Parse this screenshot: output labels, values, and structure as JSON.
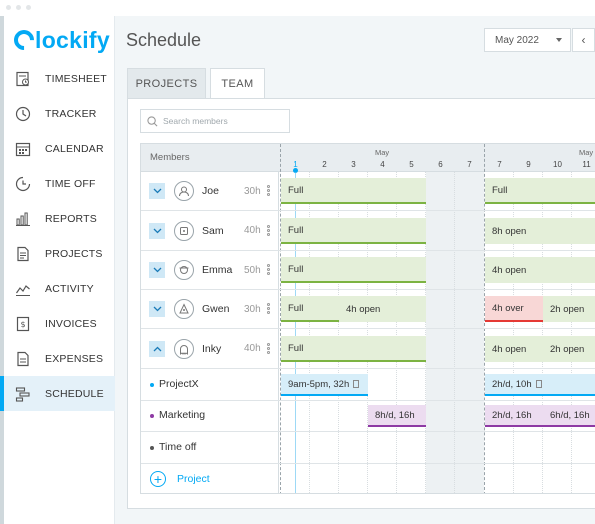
{
  "app": {
    "logo_text": "lockify",
    "brand_color": "#03a9f4"
  },
  "sidebar": {
    "items": [
      {
        "label": "TIMESHEET",
        "icon": "timesheet-icon"
      },
      {
        "label": "TRACKER",
        "icon": "clock-icon"
      },
      {
        "label": "CALENDAR",
        "icon": "calendar-icon"
      },
      {
        "label": "TIME OFF",
        "icon": "time-off-icon"
      },
      {
        "label": "REPORTS",
        "icon": "reports-icon"
      },
      {
        "label": "PROJECTS",
        "icon": "projects-icon"
      },
      {
        "label": "ACTIVITY",
        "icon": "activity-icon"
      },
      {
        "label": "INVOICES",
        "icon": "invoices-icon"
      },
      {
        "label": "EXPENSES",
        "icon": "expenses-icon"
      },
      {
        "label": "SCHEDULE",
        "icon": "schedule-icon",
        "active": true
      }
    ]
  },
  "header": {
    "title": "Schedule",
    "date_value": "May 2022",
    "prev_label": "‹"
  },
  "tabs": {
    "projects": "PROJECTS",
    "team": "TEAM"
  },
  "search": {
    "placeholder": "Search members"
  },
  "grid": {
    "members_label": "Members",
    "month_label": "May",
    "month_label_2": "May",
    "days": [
      "1",
      "2",
      "3",
      "4",
      "5",
      "6",
      "7",
      "7",
      "9",
      "10",
      "11"
    ],
    "members": [
      {
        "name": "Joe",
        "hours": "30h",
        "expanded": false,
        "bars": [
          "Full",
          "Full"
        ]
      },
      {
        "name": "Sam",
        "hours": "40h",
        "expanded": false,
        "bars": [
          "Full",
          "8h open"
        ]
      },
      {
        "name": "Emma",
        "hours": "50h",
        "expanded": false,
        "bars": [
          "Full",
          "4h open"
        ]
      },
      {
        "name": "Gwen",
        "hours": "30h",
        "expanded": false,
        "bars": [
          "Full",
          "4h open",
          "4h over",
          "2h open"
        ]
      },
      {
        "name": "Inky",
        "hours": "40h",
        "expanded": true,
        "bars": [
          "Full",
          "4h open",
          "2h open"
        ]
      }
    ],
    "projects": [
      {
        "name": "ProjectX",
        "color": "#03a9f4",
        "bars": [
          "9am-5pm, 32h",
          "2h/d, 10h"
        ]
      },
      {
        "name": "Marketing",
        "color": "#8e3aa4",
        "bars": [
          "8h/d, 16h",
          "2h/d, 16h",
          "6h/d, 16h"
        ]
      },
      {
        "name": "Time off",
        "color": "#555555",
        "bars": []
      }
    ],
    "add_project_label": "Project"
  }
}
